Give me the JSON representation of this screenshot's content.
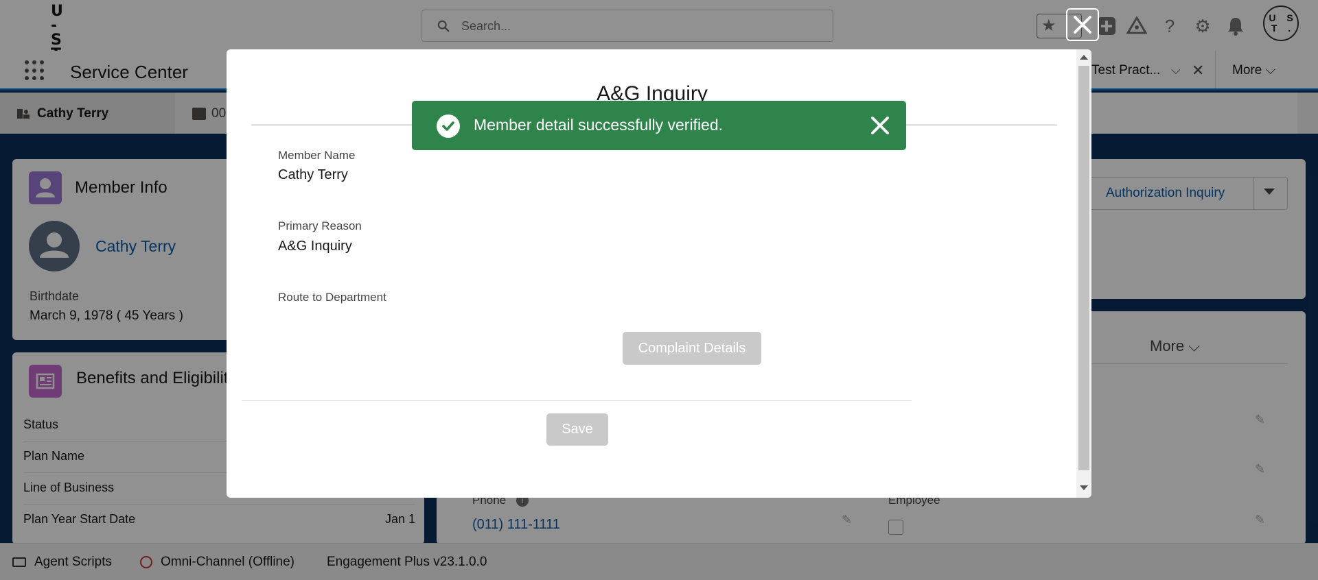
{
  "app": {
    "logo_text": "U - S T",
    "search_placeholder": "Search...",
    "app_name": "Service Center",
    "nav_tab_label": "Test Pract...",
    "nav_more": "More"
  },
  "subtabs": {
    "active_label": "Cathy Terry",
    "second_label": "00"
  },
  "member_info": {
    "title": "Member Info",
    "member_link": "Cathy Terry",
    "birthdate_label": "Birthdate",
    "birthdate_value": "March 9, 1978 ( 45 Years )"
  },
  "benefits": {
    "title": "Benefits and Eligibilit",
    "rows": [
      {
        "label": "Status",
        "value": ""
      },
      {
        "label": "Plan Name",
        "value": ""
      },
      {
        "label": "Line of Business",
        "value": ""
      },
      {
        "label": "Plan Year Start Date",
        "value": "Jan 1"
      }
    ]
  },
  "right_panel": {
    "auth_button": "Authorization Inquiry",
    "tab_partial": "s",
    "more_tab": "More",
    "phone_label": "Phone",
    "phone_value": "(011) 111-1111",
    "employee_label": "Employee"
  },
  "modal": {
    "title": "A&G Inquiry",
    "member_name_label": "Member Name",
    "member_name_value": "Cathy Terry",
    "primary_reason_label": "Primary Reason",
    "primary_reason_value": "A&G Inquiry",
    "route_label": "Route to Department",
    "complaint_button": "Complaint Details",
    "save_button": "Save"
  },
  "toast": {
    "message": "Member detail successfully verified.",
    "color": "#2e844a"
  },
  "bottom_bar": {
    "agent_scripts": "Agent Scripts",
    "omni_channel": "Omni-Channel (Offline)",
    "engagement": "Engagement Plus v23.1.0.0"
  }
}
